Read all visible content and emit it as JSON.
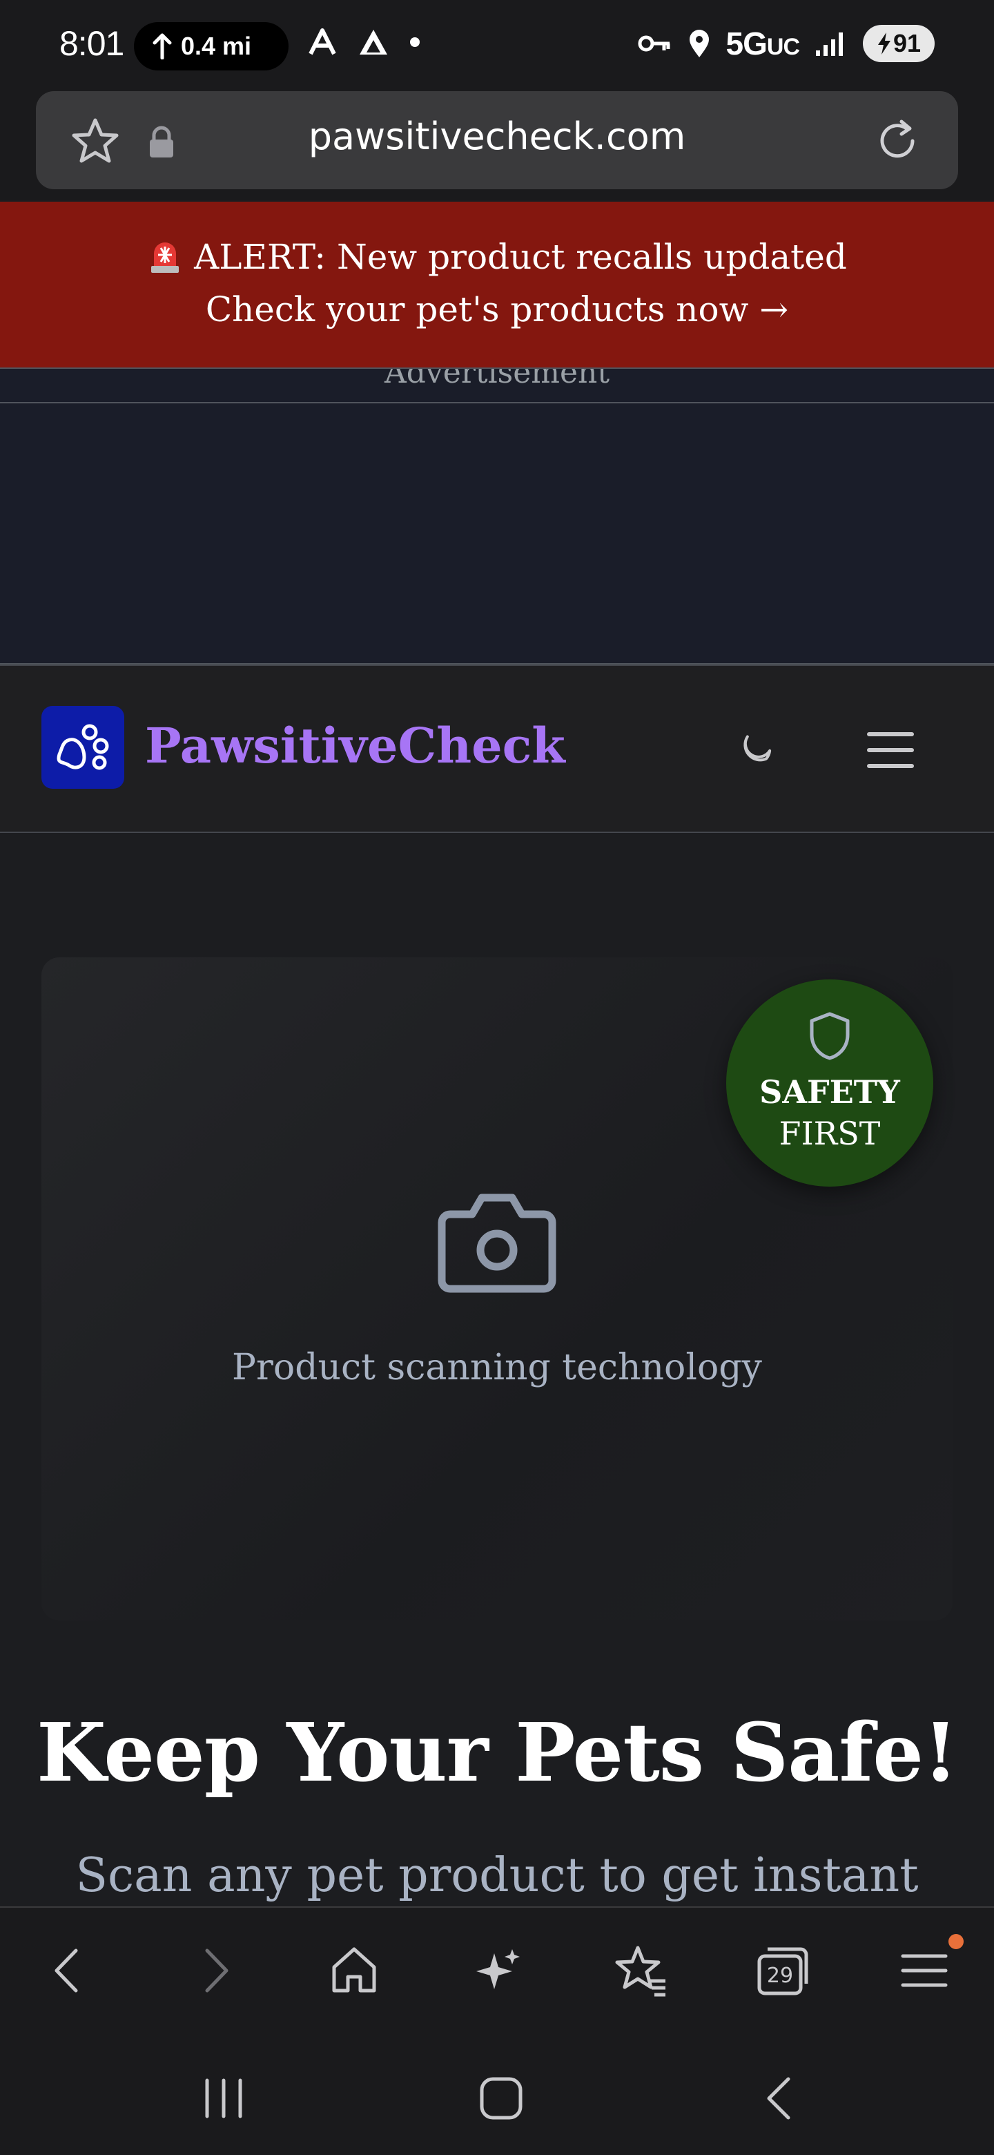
{
  "status_bar": {
    "time": "8:01",
    "nav_distance": "0.4 mi",
    "network": "5G",
    "network_suffix": "UC",
    "battery": "91"
  },
  "browser": {
    "url": "pawsitivecheck.com"
  },
  "alert": {
    "line1": "ALERT: New product recalls updated",
    "line2": "Check your pet's products now →"
  },
  "ad": {
    "label": "Advertisement"
  },
  "header": {
    "brand": "PawsitiveCheck"
  },
  "hero": {
    "badge_line1": "SAFETY",
    "badge_line2": "FIRST",
    "scan_caption": "Product scanning technology"
  },
  "main": {
    "headline": "Keep Your Pets Safe!",
    "subheadline": "Scan any pet product to get instant"
  },
  "toolbar": {
    "tabs_count": "29"
  },
  "colors": {
    "alert_bg": "#84170f",
    "brand": "#a775f5",
    "logo_bg": "#0d1ca8",
    "badge_bg": "#1e4a13",
    "notification_dot": "#e8703a"
  }
}
